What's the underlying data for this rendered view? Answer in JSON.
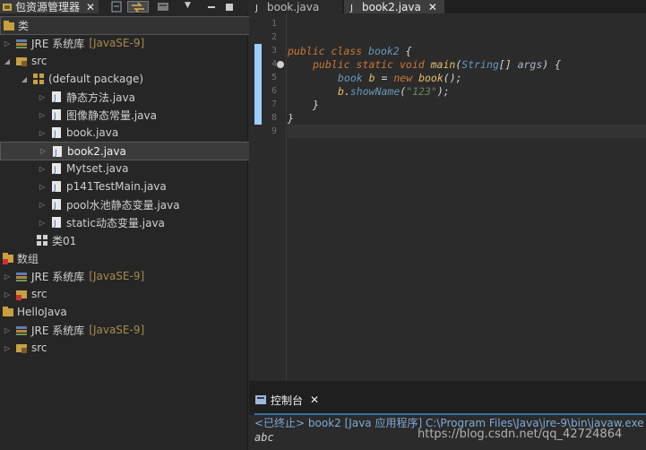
{
  "left_panel": {
    "tab_title": "包资源管理器",
    "tree": [
      {
        "label": "类",
        "level": 0,
        "type": "project",
        "expanded": true
      },
      {
        "label": "JRE 系统库",
        "decor": "[JavaSE-9]",
        "level": 1,
        "type": "library",
        "expanded": false
      },
      {
        "label": "src",
        "level": 1,
        "type": "src-folder",
        "expanded": true
      },
      {
        "label": "(default package)",
        "level": 2,
        "type": "package",
        "expanded": true
      },
      {
        "label": "静态方法.java",
        "level": 3,
        "type": "java-file"
      },
      {
        "label": "图像静态常量.java",
        "level": 3,
        "type": "java-file"
      },
      {
        "label": "book.java",
        "level": 3,
        "type": "java-file"
      },
      {
        "label": "book2.java",
        "level": 3,
        "type": "java-file",
        "selected": true
      },
      {
        "label": "Mytset.java",
        "level": 3,
        "type": "java-file"
      },
      {
        "label": "p141TestMain.java",
        "level": 3,
        "type": "java-file"
      },
      {
        "label": "pool水池静态变量.java",
        "level": 3,
        "type": "java-file"
      },
      {
        "label": "static动态变量.java",
        "level": 3,
        "type": "java-file"
      },
      {
        "label": "类01",
        "level": 2,
        "type": "package-plain"
      },
      {
        "label": "数组",
        "level": 0,
        "type": "project-error",
        "expanded": true
      },
      {
        "label": "JRE 系统库",
        "decor": "[JavaSE-9]",
        "level": 1,
        "type": "library",
        "expanded": false
      },
      {
        "label": "src",
        "level": 1,
        "type": "src-folder",
        "expanded": false
      },
      {
        "label": "HelloJava",
        "level": 0,
        "type": "project",
        "expanded": true
      },
      {
        "label": "JRE 系统库",
        "decor": "[JavaSE-9]",
        "level": 1,
        "type": "library",
        "expanded": false
      },
      {
        "label": "src",
        "level": 1,
        "type": "src-folder",
        "expanded": false
      }
    ]
  },
  "editor": {
    "tabs": [
      {
        "label": "book.java",
        "active": false
      },
      {
        "label": "book2.java",
        "active": true
      }
    ],
    "line_numbers": [
      "1",
      "2",
      "3",
      "4",
      "5",
      "6",
      "7",
      "8",
      "9"
    ],
    "code": {
      "l3": {
        "public": "public",
        "class": "class",
        "name": "book2",
        "brace": " {"
      },
      "l4": {
        "public": "public",
        "static": "static",
        "void": "void",
        "main": "main",
        "p1": "(",
        "String": "String",
        "p2": "[] ",
        "args": "args",
        "p3": ") {"
      },
      "l5": {
        "type": "book",
        "var": "b",
        "eq": " = ",
        "new": "new",
        "ctor": "book",
        "end": "();"
      },
      "l6": {
        "var": "b",
        "dot": ".",
        "method": "showName",
        "p1": "(",
        "str": "\"123\"",
        "p2": ");"
      },
      "l7": "}",
      "l8": "}"
    }
  },
  "console": {
    "tab_title": "控制台",
    "status": "<已终止> book2 [Java 应用程序] C:\\Program Files\\Java\\jre-9\\bin\\javaw.exe (",
    "output": "abc",
    "watermark": "https://blog.csdn.net/qq_42724864"
  }
}
